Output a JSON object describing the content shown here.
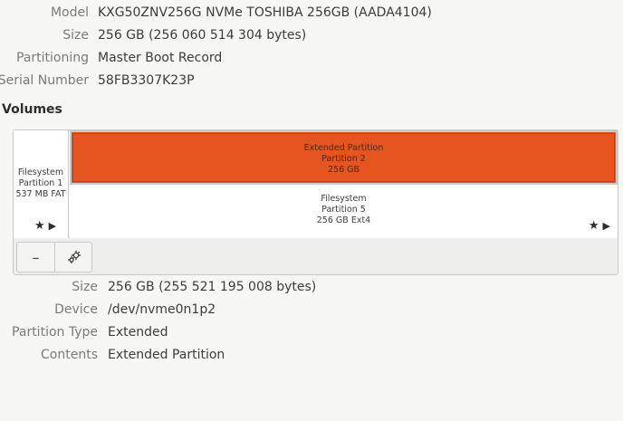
{
  "drive": {
    "properties": [
      {
        "label": "Model",
        "value": "KXG50ZNV256G NVMe TOSHIBA 256GB (AADA4104)"
      },
      {
        "label": "Size",
        "value": "256 GB (256 060 514 304 bytes)"
      },
      {
        "label": "Partitioning",
        "value": "Master Boot Record"
      },
      {
        "label": "Serial Number",
        "value": "58FB3307K23P"
      }
    ]
  },
  "volumes": {
    "heading": "Volumes",
    "partition1": {
      "line1": "Filesystem",
      "line2": "Partition 1",
      "line3": "537 MB FAT"
    },
    "extended": {
      "line1": "Extended Partition",
      "line2": "Partition 2",
      "line3": "256 GB"
    },
    "partition5": {
      "line1": "Filesystem",
      "line2": "Partition 5",
      "line3": "256 GB Ext4"
    },
    "toolbar": {
      "remove_label": "–",
      "settings_icon": "gears-icon"
    }
  },
  "selected_partition": {
    "properties": [
      {
        "label": "Size",
        "value": "256 GB (255 521 195 008 bytes)"
      },
      {
        "label": "Device",
        "value": "/dev/nvme0n1p2"
      },
      {
        "label": "Partition Type",
        "value": "Extended"
      },
      {
        "label": "Contents",
        "value": "Extended Partition"
      }
    ]
  },
  "colors": {
    "selected_partition": "#e65420",
    "background": "#f7f7f6"
  }
}
